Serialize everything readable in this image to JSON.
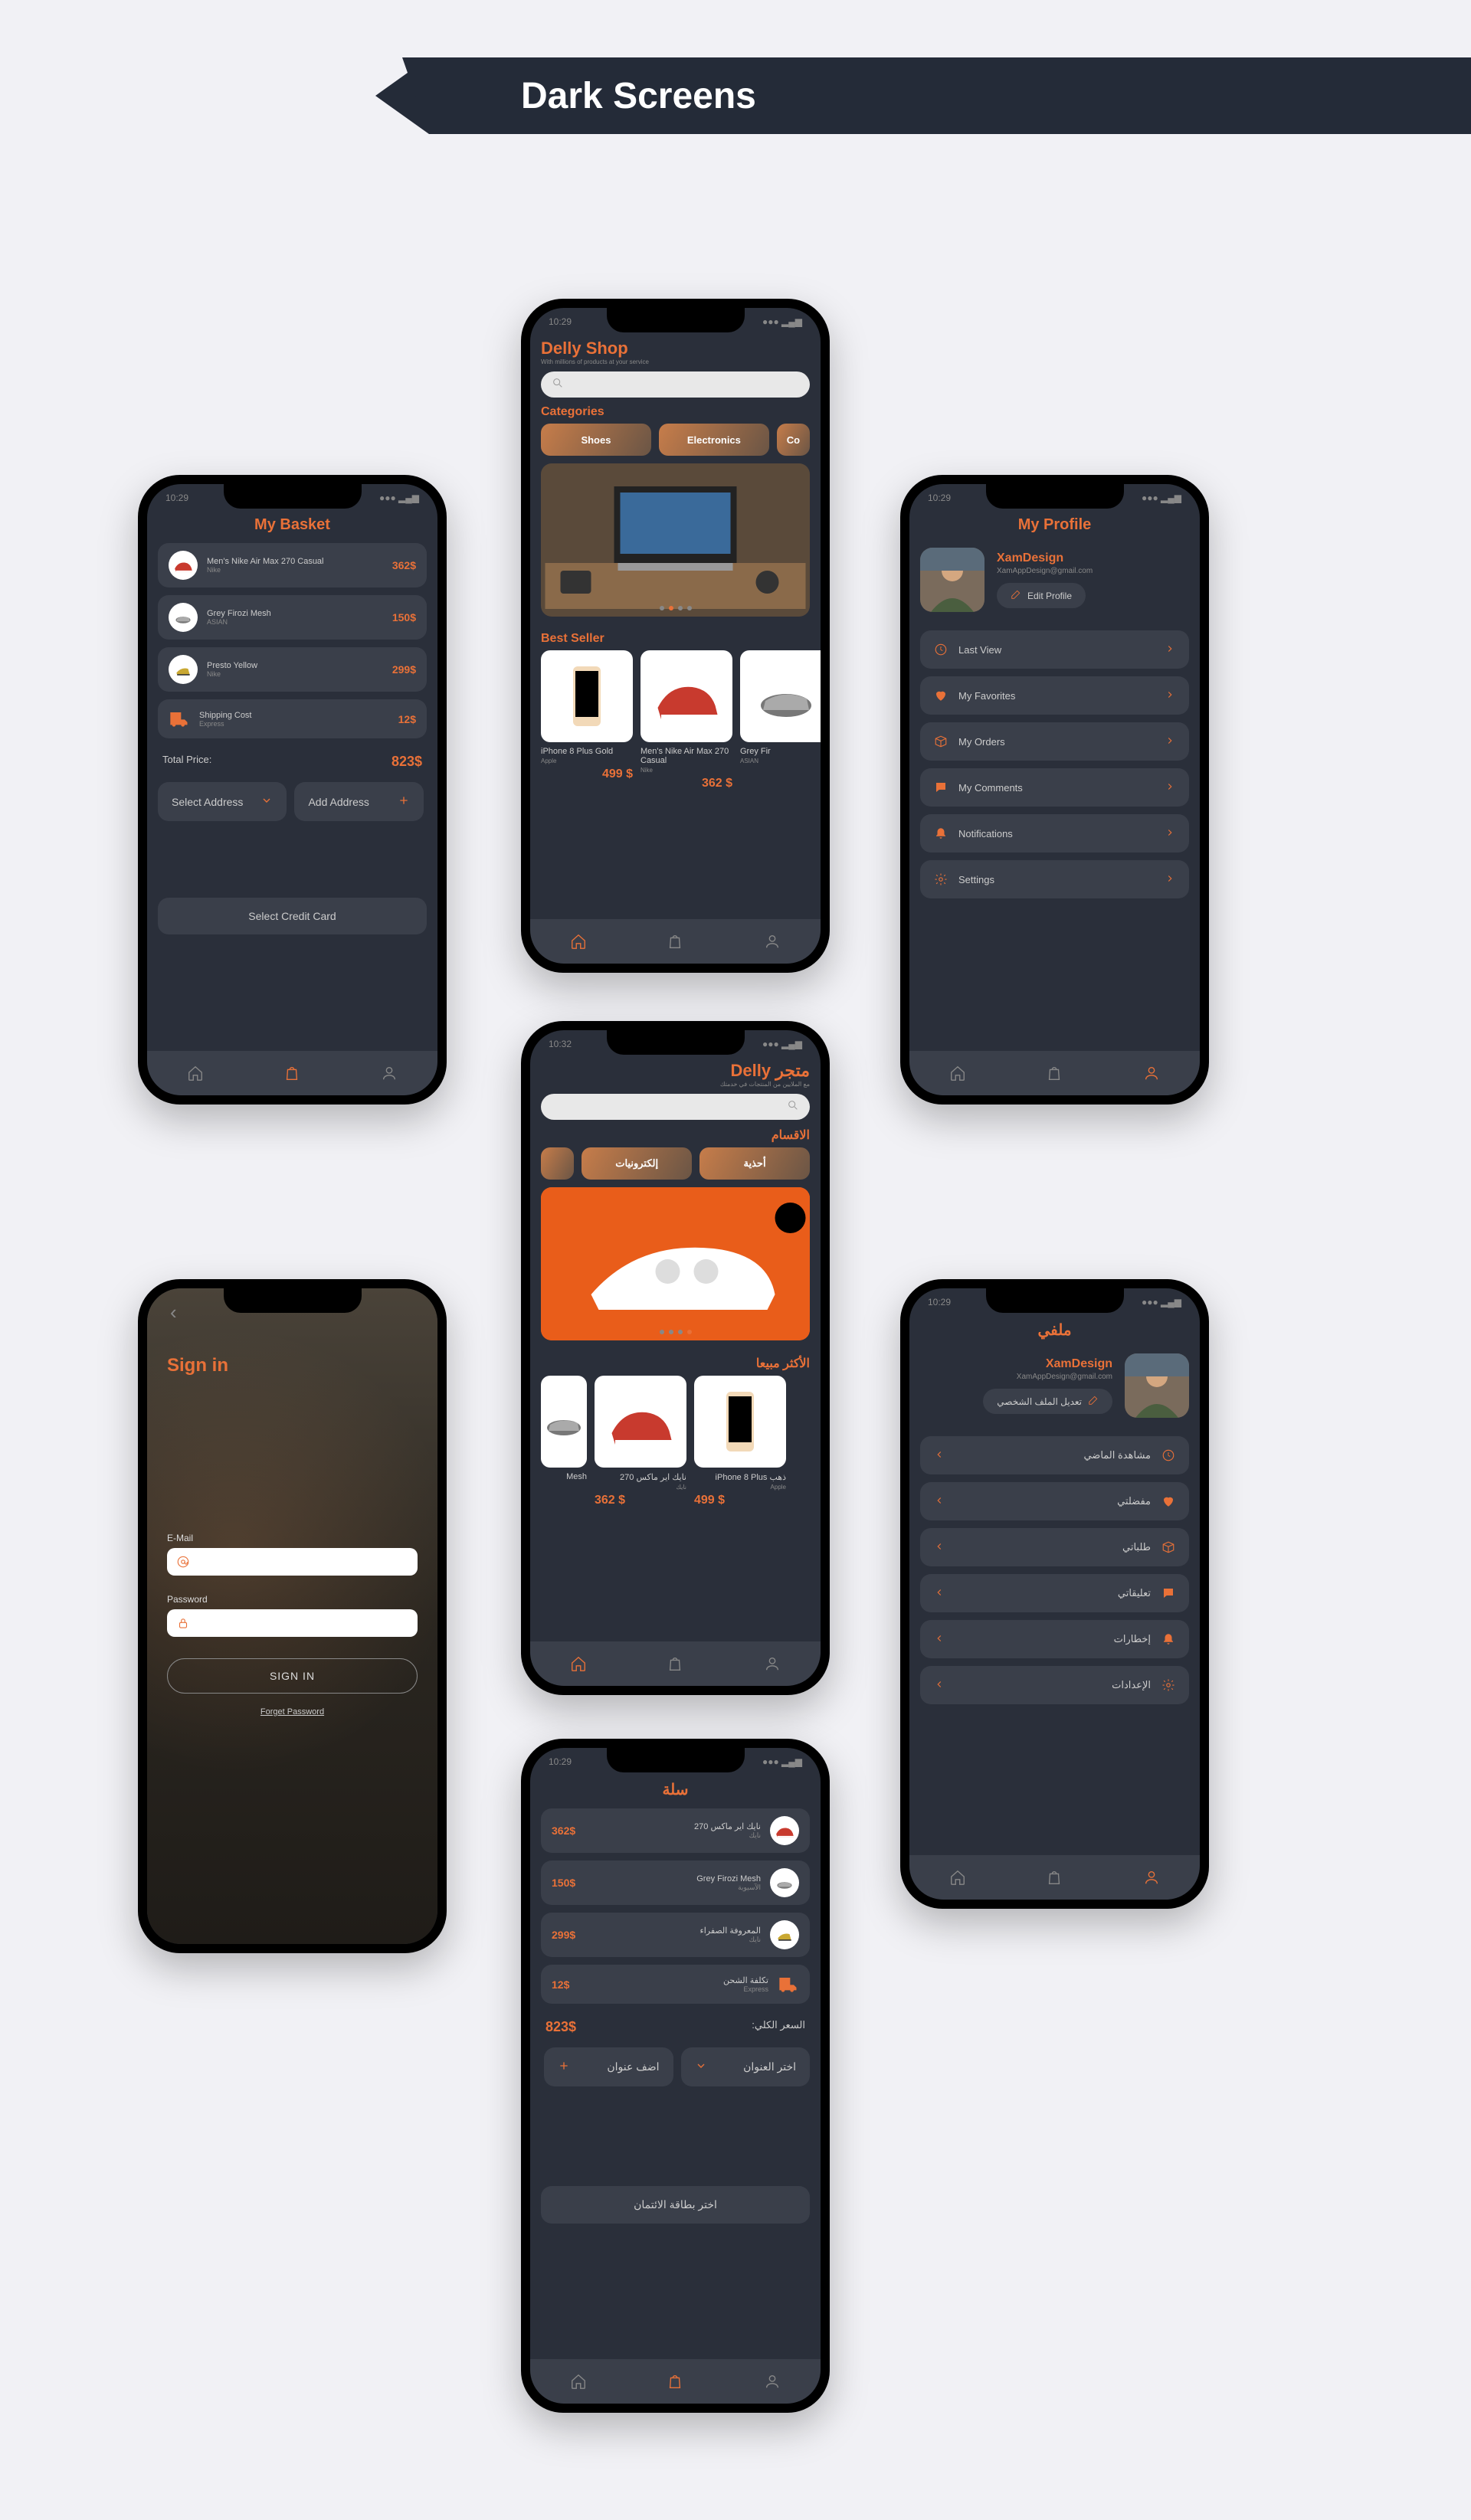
{
  "header": {
    "title": "Dark Screens"
  },
  "colors": {
    "accent": "#e97138",
    "dark": "#2a2f3a",
    "card": "#3a3f4a"
  },
  "basket_en": {
    "title": "My Basket",
    "items": [
      {
        "name": "Men's Nike Air Max 270 Casual",
        "brand": "Nike",
        "price": "362$"
      },
      {
        "name": "Grey Firozi Mesh",
        "brand": "ASIAN",
        "price": "150$"
      },
      {
        "name": "Presto Yellow",
        "brand": "Nike",
        "price": "299$"
      }
    ],
    "shipping": {
      "label": "Shipping Cost",
      "method": "Express",
      "price": "12$"
    },
    "total": {
      "label": "Total Price:",
      "price": "823$"
    },
    "select_address": "Select Address",
    "add_address": "Add Address",
    "select_card": "Select Credit Card"
  },
  "shop_en": {
    "title": "Delly Shop",
    "subtitle": "With millions of products at your service",
    "categories_label": "Categories",
    "categories": [
      "Shoes",
      "Electronics",
      "Co"
    ],
    "best_seller_label": "Best Seller",
    "products": [
      {
        "name": "iPhone 8 Plus Gold",
        "brand": "Apple",
        "price": "499 $"
      },
      {
        "name": "Men's Nike Air Max 270 Casual",
        "brand": "Nike",
        "price": "362 $"
      },
      {
        "name": "Grey Fir",
        "brand": "ASIAN",
        "price": ""
      }
    ]
  },
  "profile_en": {
    "title": "My Profile",
    "name": "XamDesign",
    "email": "XamAppDesign@gmail.com",
    "edit": "Edit Profile",
    "menu": [
      "Last View",
      "My Favorites",
      "My Orders",
      "My Comments",
      "Notifications",
      "Settings"
    ]
  },
  "signin": {
    "title": "Sign in",
    "email_label": "E-Mail",
    "password_label": "Password",
    "button": "SIGN IN",
    "forgot": "Forget Password"
  },
  "shop_ar": {
    "title": "متجر Delly",
    "subtitle": "مع الملايين من المنتجات في خدمتك",
    "categories_label": "الاقسام",
    "categories": [
      "أحذية",
      "إلكترونيات"
    ],
    "best_seller_label": "الأكثر مبيعا",
    "products": [
      {
        "name": "Mesh",
        "brand": "",
        "price": ""
      },
      {
        "name": "نايك اير ماكس 270",
        "brand": "نايك",
        "price": "362 $"
      },
      {
        "name": "iPhone 8 Plus ذهب",
        "brand": "Apple",
        "price": "499 $"
      }
    ]
  },
  "profile_ar": {
    "title": "ملفي",
    "name": "XamDesign",
    "email": "XamAppDesign@gmail.com",
    "edit": "تعديل الملف الشخصي",
    "menu": [
      "مشاهدة الماضي",
      "مفضلتي",
      "طلباتي",
      "تعليقاتي",
      "إخطارات",
      "الإعدادات"
    ]
  },
  "basket_ar": {
    "title": "سلة",
    "items": [
      {
        "name": "نايك اير ماكس 270",
        "brand": "نايك",
        "price": "362$"
      },
      {
        "name": "Grey Firozi Mesh",
        "brand": "الآسيوية",
        "price": "150$"
      },
      {
        "name": "المعروفة الصفراء",
        "brand": "نايك",
        "price": "299$"
      }
    ],
    "shipping": {
      "label": "تكلفة الشحن",
      "method": "Express",
      "price": "12$"
    },
    "total": {
      "label": "السعر الكلي:",
      "price": "823$"
    },
    "select_address": "اختر العنوان",
    "add_address": "اضف عنوان",
    "select_card": "اختر بطاقة الائتمان"
  },
  "status_time": "10:29"
}
